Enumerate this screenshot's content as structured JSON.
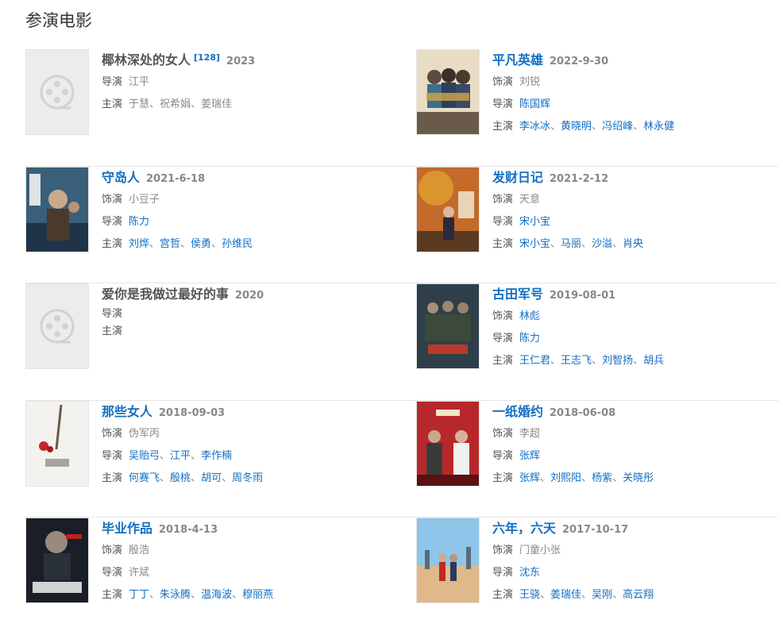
{
  "section_title": "参演电影",
  "labels": {
    "role": "饰演",
    "director": "导演",
    "cast": "主演",
    "sep": "、"
  },
  "movies": [
    {
      "title": "椰林深处的女人",
      "ref": "[128]",
      "year": "2023",
      "role": "",
      "director": "江平",
      "cast": [
        "于慧",
        "祝希娟",
        "姜瑞佳"
      ],
      "poster": "placeholder-film-icon"
    },
    {
      "title": "平凡英雄",
      "year": "2022-9-30",
      "role": "刘锐",
      "director": "陈国辉",
      "cast": [
        "李冰冰",
        "黄晓明",
        "冯绍峰",
        "林永健"
      ],
      "poster": "poster-image"
    },
    {
      "title": "守岛人",
      "year": "2021-6-18",
      "role": "小豆子",
      "director": "陈力",
      "cast": [
        "刘烨",
        "宫哲",
        "侯勇",
        "孙维民"
      ],
      "poster": "poster-image"
    },
    {
      "title": "发财日记",
      "year": "2021-2-12",
      "role": "天意",
      "director": "宋小宝",
      "cast": [
        "宋小宝",
        "马丽",
        "沙溢",
        "肖央"
      ],
      "poster": "poster-image"
    },
    {
      "title": "爱你是我做过最好的事",
      "year": "2020",
      "role": "",
      "director": "",
      "cast": [],
      "poster": "placeholder-film-icon"
    },
    {
      "title": "古田军号",
      "year": "2019-08-01",
      "role": "林彪",
      "director": "陈力",
      "cast": [
        "王仁君",
        "王志飞",
        "刘智扬",
        "胡兵"
      ],
      "poster": "poster-image"
    },
    {
      "title": "那些女人",
      "year": "2018-09-03",
      "role": "伪军丙",
      "director": "吴贻弓",
      "director_more": [
        "江平",
        "李作楠"
      ],
      "cast": [
        "何赛飞",
        "殷桃",
        "胡可",
        "周冬雨"
      ],
      "poster": "poster-image"
    },
    {
      "title": "一纸婚约",
      "year": "2018-06-08",
      "role": "李超",
      "director": "张辉",
      "cast": [
        "张辉",
        "刘熙阳",
        "杨紫",
        "关晓彤"
      ],
      "poster": "poster-image"
    },
    {
      "title": "毕业作品",
      "year": "2018-4-13",
      "role": "殷浩",
      "director": "许斌",
      "cast": [
        "丁丁",
        "朱泳腾",
        "温海波",
        "穆丽燕"
      ],
      "poster": "poster-image"
    },
    {
      "title": "六年，六天",
      "year": "2017-10-17",
      "role": "门童小张",
      "director": "沈东",
      "cast": [
        "王骁",
        "姜瑞佳",
        "吴刚",
        "高云翔"
      ],
      "poster": "poster-image"
    }
  ],
  "colors": {
    "link": "#136ec2",
    "muted": "#888888",
    "label": "#555555",
    "divider": "#e6e6e6"
  }
}
